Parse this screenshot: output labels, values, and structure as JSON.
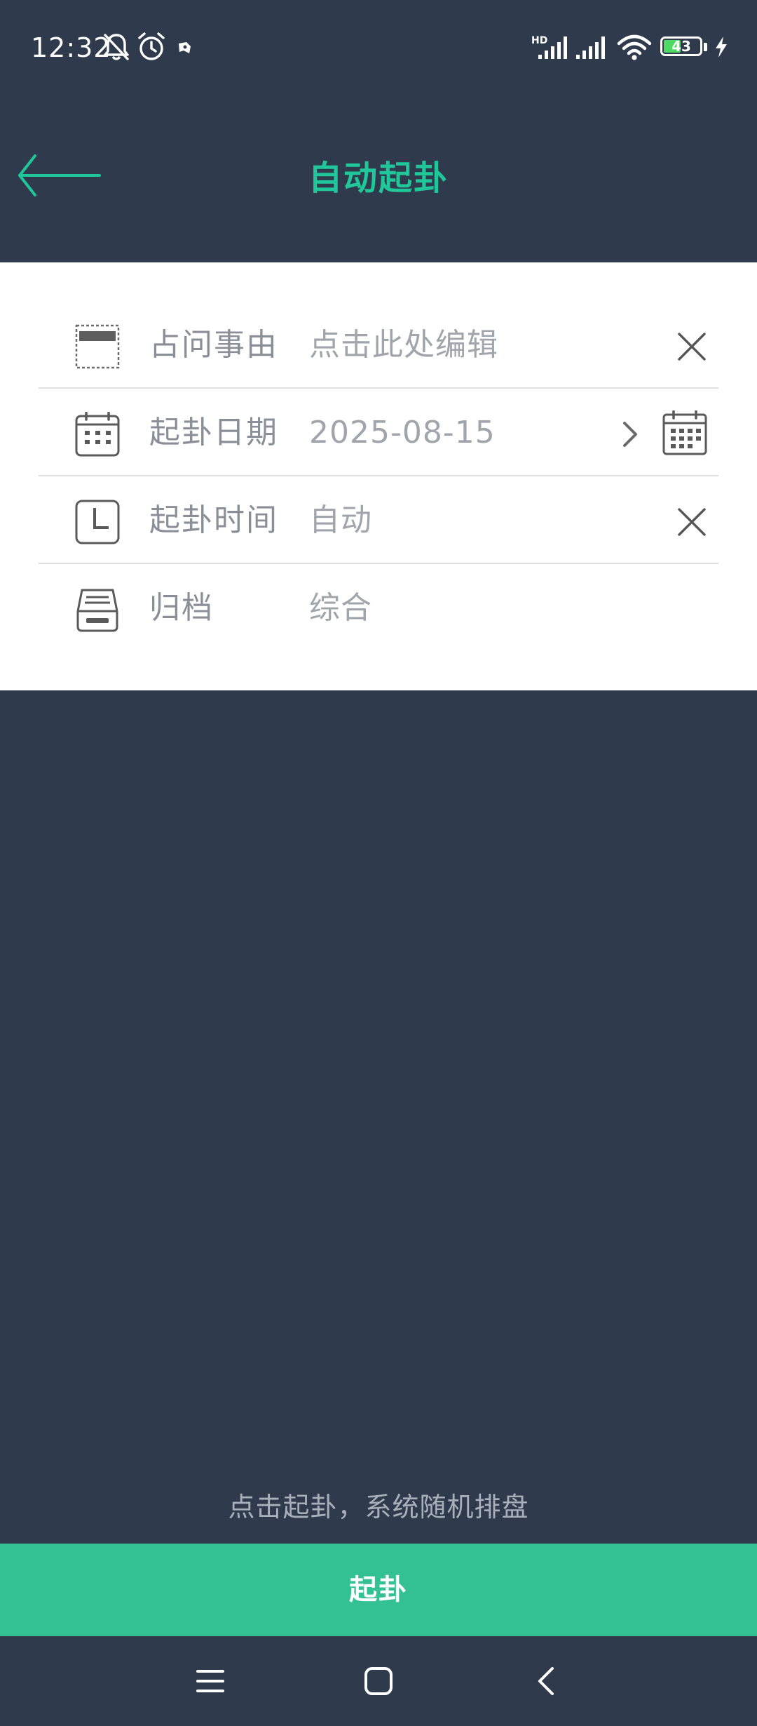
{
  "status_bar": {
    "time": "12:32",
    "battery_level": "43",
    "icons": [
      "bell-off-icon",
      "alarm-icon",
      "app-notification-icon",
      "hd-signal-icon",
      "signal-icon",
      "wifi-icon",
      "battery-icon",
      "charging-icon"
    ],
    "hd_label": "HD"
  },
  "header": {
    "title": "自动起卦",
    "back_icon": "arrow-left-icon"
  },
  "colors": {
    "accent": "#1fc79a",
    "button": "#33c194",
    "background": "#2f3b4c",
    "card": "#ffffff"
  },
  "form": {
    "rows": [
      {
        "icon": "note-icon",
        "label": "占问事由",
        "value": "点击此处编辑",
        "action_icon": "close-icon"
      },
      {
        "icon": "calendar-icon",
        "label": "起卦日期",
        "value": "2025-08-15",
        "action_icon": "calendar-icon"
      },
      {
        "icon": "clock-icon",
        "label": "起卦时间",
        "value": "自动",
        "action_icon": "close-icon"
      },
      {
        "icon": "archive-icon",
        "label": "归档",
        "value": "综合"
      }
    ]
  },
  "hint": "点击起卦，系统随机排盘",
  "start_button_label": "起卦",
  "nav": {
    "icons": [
      "menu-icon",
      "home-icon",
      "back-icon"
    ]
  }
}
